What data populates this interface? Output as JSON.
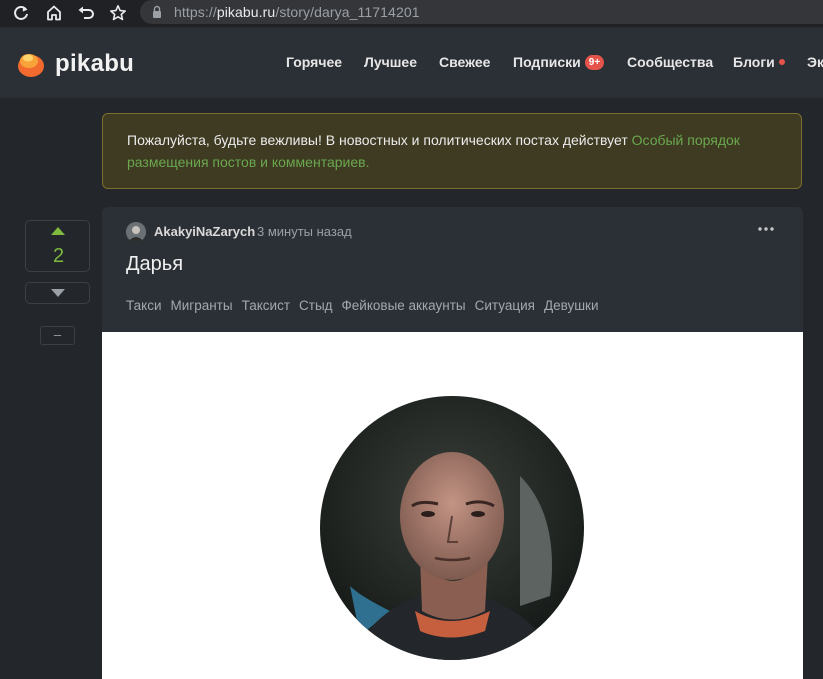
{
  "browser": {
    "url_scheme": "https://",
    "url_host": "pikabu.ru",
    "url_path": "/story/darya_11714201"
  },
  "header": {
    "logo_text": "pikabu",
    "nav": [
      {
        "label": "Горячее"
      },
      {
        "label": "Лучшее"
      },
      {
        "label": "Свежее"
      },
      {
        "label": "Подписки",
        "badge": "9+"
      },
      {
        "label": "Сообщества"
      },
      {
        "label": "Блоги"
      },
      {
        "label": "Эк"
      }
    ]
  },
  "notice": {
    "text": "Пожалуйста, будьте вежливы! В новостных и политических постах действует ",
    "link": "Особый порядок размещения постов и комментариев."
  },
  "vote": {
    "count": "2",
    "collapse_label": "–"
  },
  "story": {
    "author": "AkakyiNaZarych",
    "time": "3 минуты назад",
    "title": "Дарья",
    "tags": [
      "Такси",
      "Мигранты",
      "Таксист",
      "Стыд",
      "Фейковые аккаунты",
      "Ситуация",
      "Девушки"
    ]
  },
  "colors": {
    "accent_green": "#7fb93f",
    "link_green": "#6aa84f",
    "badge_red": "#e5544a",
    "logo_orange": "#f26a2e"
  }
}
